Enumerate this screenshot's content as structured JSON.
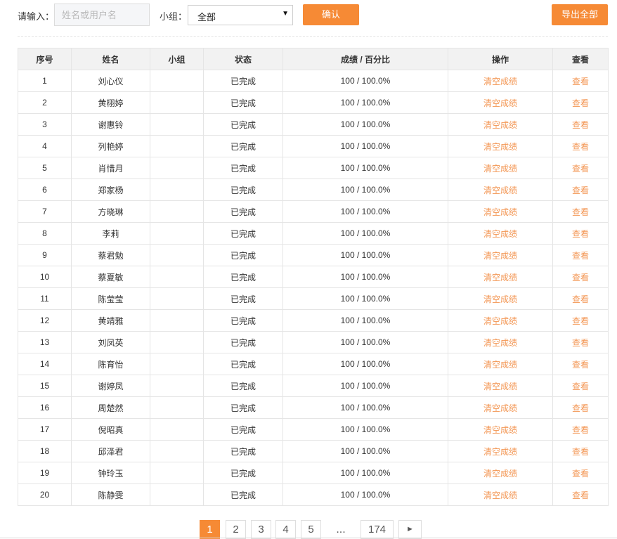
{
  "filters": {
    "input_label": "请输入：",
    "search_placeholder": "姓名或用户名",
    "group_label": "小组：",
    "group_value": "全部",
    "confirm_label": "确认",
    "export_label": "导出全部"
  },
  "table": {
    "headers": [
      "序号",
      "姓名",
      "小组",
      "状态",
      "成绩 / 百分比",
      "操作",
      "查看"
    ],
    "rows": [
      {
        "index": "1",
        "name": "刘心仪",
        "group": "",
        "status": "已完成",
        "score": "100 / 100.0%",
        "action": "清空成绩",
        "view": "查看"
      },
      {
        "index": "2",
        "name": "黄栩婷",
        "group": "",
        "status": "已完成",
        "score": "100 / 100.0%",
        "action": "清空成绩",
        "view": "查看"
      },
      {
        "index": "3",
        "name": "谢惠铃",
        "group": "",
        "status": "已完成",
        "score": "100 / 100.0%",
        "action": "清空成绩",
        "view": "查看"
      },
      {
        "index": "4",
        "name": "列艳婷",
        "group": "",
        "status": "已完成",
        "score": "100 / 100.0%",
        "action": "清空成绩",
        "view": "查看"
      },
      {
        "index": "5",
        "name": "肖惜月",
        "group": "",
        "status": "已完成",
        "score": "100 / 100.0%",
        "action": "清空成绩",
        "view": "查看"
      },
      {
        "index": "6",
        "name": "郑家杨",
        "group": "",
        "status": "已完成",
        "score": "100 / 100.0%",
        "action": "清空成绩",
        "view": "查看"
      },
      {
        "index": "7",
        "name": "方晓琳",
        "group": "",
        "status": "已完成",
        "score": "100 / 100.0%",
        "action": "清空成绩",
        "view": "查看"
      },
      {
        "index": "8",
        "name": "李莉",
        "group": "",
        "status": "已完成",
        "score": "100 / 100.0%",
        "action": "清空成绩",
        "view": "查看"
      },
      {
        "index": "9",
        "name": "蔡君勉",
        "group": "",
        "status": "已完成",
        "score": "100 / 100.0%",
        "action": "清空成绩",
        "view": "查看"
      },
      {
        "index": "10",
        "name": "蔡夏敏",
        "group": "",
        "status": "已完成",
        "score": "100 / 100.0%",
        "action": "清空成绩",
        "view": "查看"
      },
      {
        "index": "11",
        "name": "陈莹莹",
        "group": "",
        "status": "已完成",
        "score": "100 / 100.0%",
        "action": "清空成绩",
        "view": "查看"
      },
      {
        "index": "12",
        "name": "黄靖雅",
        "group": "",
        "status": "已完成",
        "score": "100 / 100.0%",
        "action": "清空成绩",
        "view": "查看"
      },
      {
        "index": "13",
        "name": "刘凤英",
        "group": "",
        "status": "已完成",
        "score": "100 / 100.0%",
        "action": "清空成绩",
        "view": "查看"
      },
      {
        "index": "14",
        "name": "陈育怡",
        "group": "",
        "status": "已完成",
        "score": "100 / 100.0%",
        "action": "清空成绩",
        "view": "查看"
      },
      {
        "index": "15",
        "name": "谢婷凤",
        "group": "",
        "status": "已完成",
        "score": "100 / 100.0%",
        "action": "清空成绩",
        "view": "查看"
      },
      {
        "index": "16",
        "name": "周楚然",
        "group": "",
        "status": "已完成",
        "score": "100 / 100.0%",
        "action": "清空成绩",
        "view": "查看"
      },
      {
        "index": "17",
        "name": "倪昭真",
        "group": "",
        "status": "已完成",
        "score": "100 / 100.0%",
        "action": "清空成绩",
        "view": "查看"
      },
      {
        "index": "18",
        "name": "邱泽君",
        "group": "",
        "status": "已完成",
        "score": "100 / 100.0%",
        "action": "清空成绩",
        "view": "查看"
      },
      {
        "index": "19",
        "name": "钟玲玉",
        "group": "",
        "status": "已完成",
        "score": "100 / 100.0%",
        "action": "清空成绩",
        "view": "查看"
      },
      {
        "index": "20",
        "name": "陈静雯",
        "group": "",
        "status": "已完成",
        "score": "100 / 100.0%",
        "action": "清空成绩",
        "view": "查看"
      }
    ]
  },
  "pagination": {
    "pages": [
      "1",
      "2",
      "3",
      "4",
      "5"
    ],
    "current": "1",
    "ellipsis": "...",
    "last": "174",
    "next_icon": "next-arrow-icon",
    "next_glyph": "►"
  },
  "colors": {
    "accent": "#f68a35",
    "link": "#f39653",
    "header_bg": "#f2f2f2"
  }
}
